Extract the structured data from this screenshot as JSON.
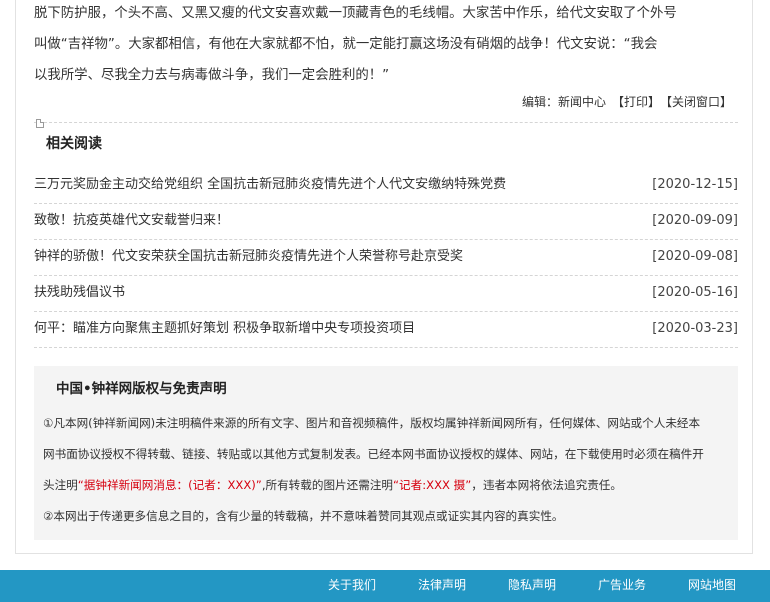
{
  "article": {
    "paragraph_lines": [
      "脱下防护服，个头不高、又黑又瘦的代文安喜欢戴一顶藏青色的毛线帽。大家苦中作乐，给代文安取了个外号",
      "叫做“吉祥物”。大家都相信，有他在大家就都不怕，就一定能打赢这场没有硝烟的战争！代文安说：“我会",
      "以我所学、尽我全力去与病毒做斗争，我们一定会胜利的！”"
    ],
    "editor_label": "编辑：新闻中心",
    "print_label": "【打印】",
    "close_label": "【关闭窗口】"
  },
  "related": {
    "title": "相关阅读",
    "items": [
      {
        "title": "三万元奖励金主动交给党组织 全国抗击新冠肺炎疫情先进个人代文安缴纳特殊党费",
        "date": "[2020-12-15]"
      },
      {
        "title": "致敬！抗疫英雄代文安载誉归来！",
        "date": "[2020-09-09]"
      },
      {
        "title": "钟祥的骄傲！代文安荣获全国抗击新冠肺炎疫情先进个人荣誉称号赴京受奖",
        "date": "[2020-09-08]"
      },
      {
        "title": "扶残助残倡议书",
        "date": "[2020-05-16]"
      },
      {
        "title": "何平：瞄准方向聚焦主题抓好策划 积极争取新增中央专项投资项目",
        "date": "[2020-03-23]"
      }
    ]
  },
  "disclaimer": {
    "title": "中国•钟祥网版权与免责声明",
    "line1": "①凡本网(钟祥新闻网)未注明稿件来源的所有文字、图片和音视频稿件，版权均属钟祥新闻网所有，任何媒体、网站或个人未经本",
    "line2": "网书面协议授权不得转载、链接、转贴或以其他方式复制发表。已经本网书面协议授权的媒体、网站，在下载使用时必须在稿件开",
    "line3_pre": "头注明",
    "line3_red1": "“据钟祥新闻网消息：(记者：XXX)”",
    "line3_mid": ",所有转载的图片还需注明",
    "line3_red2": "“记者:XXX 摄”",
    "line3_post": "，违者本网将依法追究责任。",
    "line4": "②本网出于传递更多信息之目的，含有少量的转载稿，并不意味着赞同其观点或证实其内容的真实性。"
  },
  "footer": {
    "links": [
      "关于我们",
      "法律声明",
      "隐私声明",
      "广告业务",
      "网站地图"
    ]
  },
  "colors": {
    "footer_bg": "#2397c4",
    "disclaimer_bg": "#f4f4f4",
    "highlight_red": "#d6000f"
  }
}
